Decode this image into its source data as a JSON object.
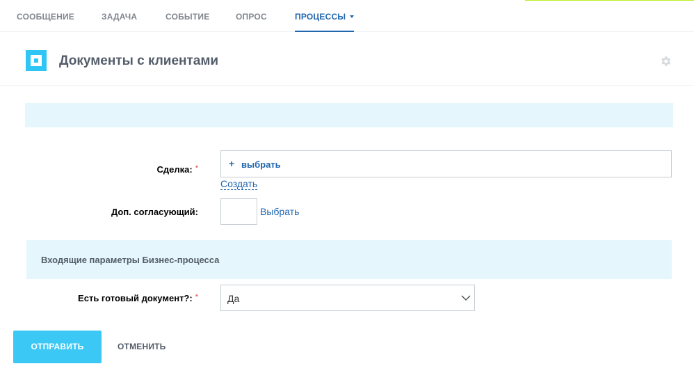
{
  "tabs": [
    {
      "label": "СООБЩЕНИЕ"
    },
    {
      "label": "ЗАДАЧА"
    },
    {
      "label": "СОБЫТИЕ"
    },
    {
      "label": "ОПРОС"
    },
    {
      "label": "ПРОЦЕССЫ",
      "active": true
    }
  ],
  "header": {
    "title": "Документы с клиентами",
    "logo_icon": "process-logo-icon",
    "settings_icon": "gear-icon"
  },
  "form": {
    "deal": {
      "label": "Сделка:",
      "required_mark": "*",
      "select_plus": "+",
      "select_label": "выбрать",
      "create_link": "Создать"
    },
    "approver": {
      "label": "Доп. согласующий:",
      "select_link": "Выбрать"
    },
    "section": {
      "title": "Входящие параметры Бизнес-процесса"
    },
    "ready_doc": {
      "label": "Есть готовый документ?:",
      "required_mark": "*",
      "value": "Да"
    }
  },
  "actions": {
    "submit_label": "ОТПРАВИТЬ",
    "cancel_label": "ОТМЕНИТЬ"
  },
  "colors": {
    "accent": "#2fc6f6",
    "link": "#2067b0",
    "button": "#3bc8f5",
    "info_bg": "#e5f7fd",
    "required": "#e03d3d"
  }
}
